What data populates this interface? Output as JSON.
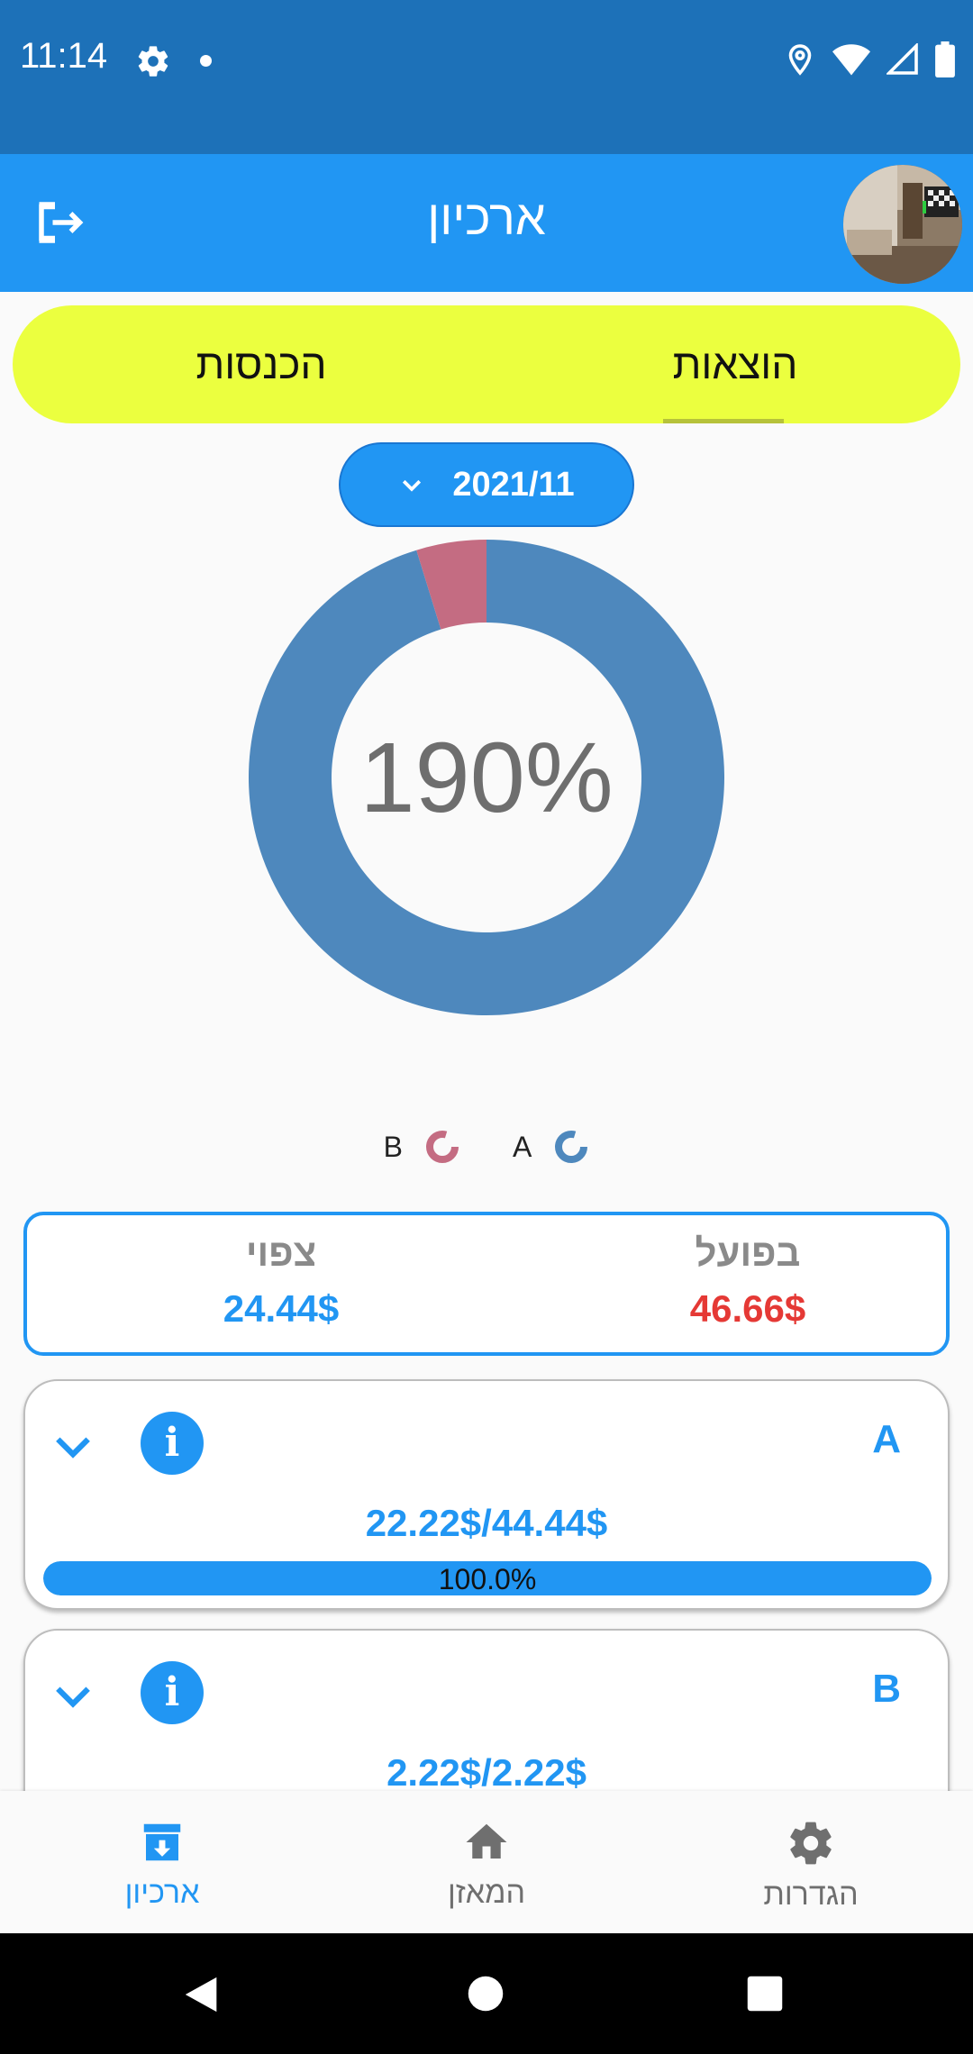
{
  "status_bar": {
    "time": "11:14"
  },
  "app_bar": {
    "title": "ארכיון"
  },
  "tabs": {
    "expenses": "הוצאות",
    "income": "הכנסות",
    "selected": "expenses"
  },
  "month_picker": {
    "value": "2021/11"
  },
  "chart_data": {
    "type": "pie",
    "center_label": "190%",
    "series": [
      {
        "name": "A",
        "value": 44.44,
        "color": "#4e88bd"
      },
      {
        "name": "B",
        "value": 2.22,
        "color": "#c46c82"
      }
    ]
  },
  "legend": [
    {
      "label": "A",
      "color": "#4e88bd"
    },
    {
      "label": "B",
      "color": "#c46c82"
    }
  ],
  "summary": {
    "actual_label": "בפועל",
    "actual_value": "46.66$",
    "expected_label": "צפוי",
    "expected_value": "24.44$",
    "colors": {
      "actual": "#e53935",
      "expected": "#2196f3"
    }
  },
  "categories": [
    {
      "name": "A",
      "amount": "22.22$/44.44$",
      "progress_text": "100.0%",
      "progress": 1.0
    },
    {
      "name": "B",
      "amount": "2.22$/2.22$"
    }
  ],
  "bottom_nav": {
    "archive": "ארכיון",
    "balance": "המאזן",
    "settings": "הגדרות",
    "active": "archive"
  }
}
